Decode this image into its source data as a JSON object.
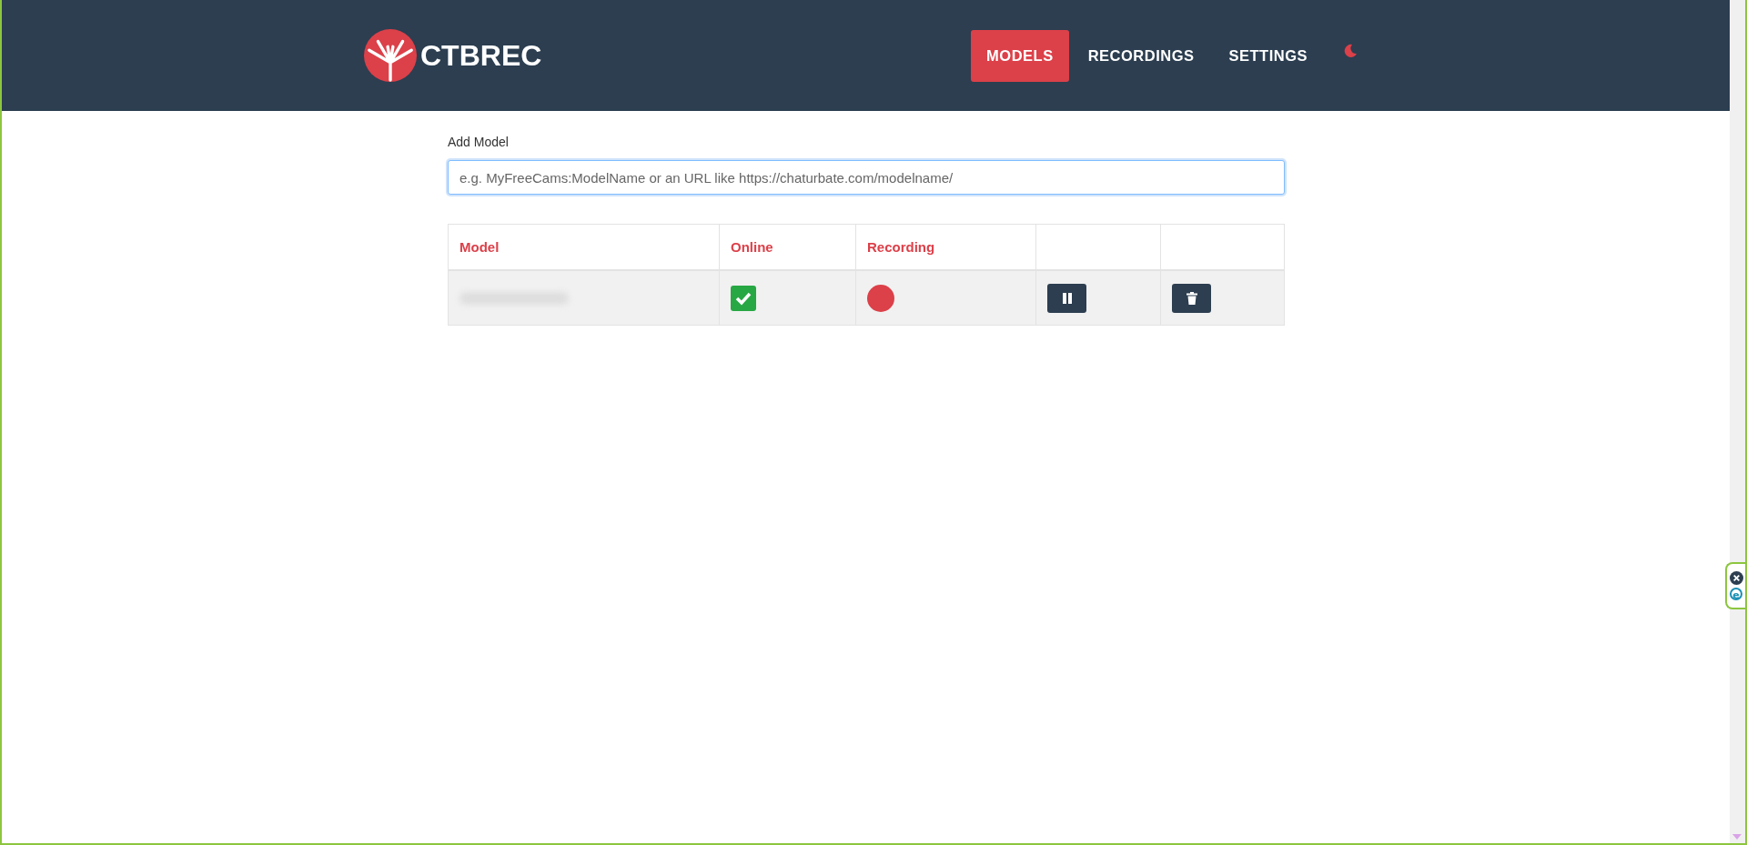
{
  "brand": {
    "name": "CTBREC"
  },
  "nav": [
    {
      "label": "MODELS",
      "selected": true
    },
    {
      "label": "RECORDINGS",
      "selected": false
    },
    {
      "label": "SETTINGS",
      "selected": false
    }
  ],
  "add_model": {
    "label": "Add Model",
    "placeholder": "e.g. MyFreeCams:ModelName or an URL like https://chaturbate.com/modelname/"
  },
  "table": {
    "columns": [
      "Model",
      "Online",
      "Recording"
    ],
    "rows": [
      {
        "online": true,
        "recording": true
      }
    ]
  },
  "side_widget": {
    "logo_letter": "e"
  }
}
